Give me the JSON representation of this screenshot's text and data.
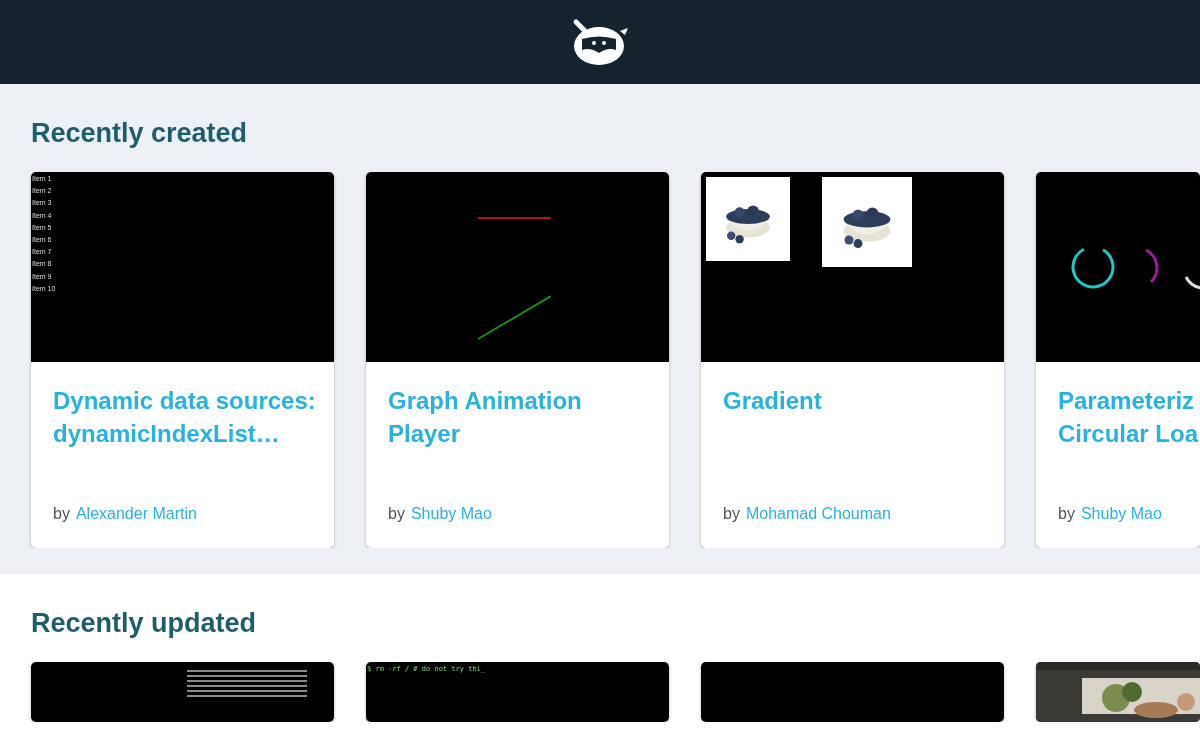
{
  "sections": [
    {
      "title": "Recently created",
      "cards": [
        {
          "title": "Dynamic data sources: dynamicIndexList…",
          "by": "by",
          "author": "Alexander Martin",
          "preview": {
            "kind": "list",
            "items": [
              "Item 1",
              "Item 2",
              "Item 3",
              "Item 4",
              "Item 5",
              "Item 6",
              "Item 7",
              "Item 8",
              "Item 9",
              "Item 10"
            ]
          }
        },
        {
          "title": "Graph Animation Player",
          "by": "by",
          "author": "Shuby Mao",
          "preview": {
            "kind": "graph"
          }
        },
        {
          "title": "Gradient",
          "by": "by",
          "author": "Mohamad Chouman",
          "preview": {
            "kind": "pictures"
          }
        },
        {
          "title": "Parameteriz Circular Loa",
          "by": "by",
          "author": "Shuby Mao",
          "preview": {
            "kind": "loaders"
          }
        }
      ]
    },
    {
      "title": "Recently updated",
      "cards": [
        {
          "preview": {
            "kind": "binary"
          }
        },
        {
          "preview": {
            "kind": "terminal",
            "text": "$ rm -rf / # do not try thi_"
          }
        },
        {
          "preview": {
            "kind": "blank"
          }
        },
        {
          "preview": {
            "kind": "picture"
          }
        }
      ]
    }
  ]
}
